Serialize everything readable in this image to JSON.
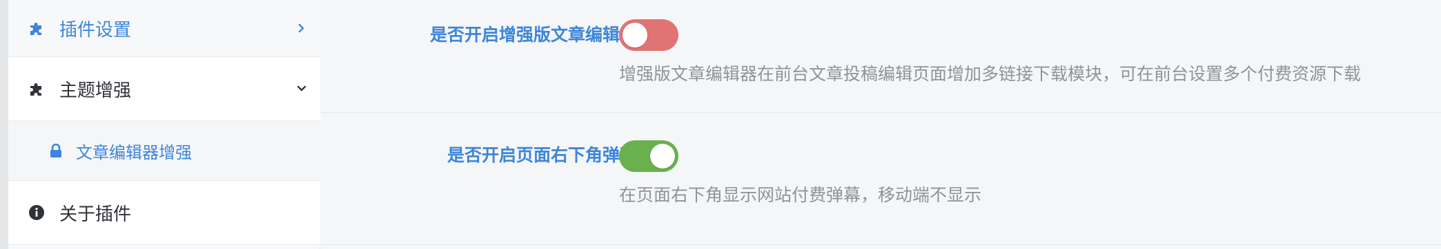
{
  "sidebar": {
    "items": [
      {
        "label": "插件设置",
        "icon": "puzzle-icon",
        "chevron": "chevron-right-icon",
        "state": "active"
      },
      {
        "label": "主题增强",
        "icon": "puzzle-icon",
        "chevron": "chevron-down-icon",
        "state": "expanded"
      },
      {
        "label": "文章编辑器增强",
        "icon": "lock-icon",
        "state": "selected-sub"
      },
      {
        "label": "关于插件",
        "icon": "info-icon"
      }
    ]
  },
  "settings": [
    {
      "label": "是否开启增强版文章编辑器",
      "enabled": false,
      "description": "增强版文章编辑器在前台文章投稿编辑页面增加多链接下载模块，可在前台设置多个付费资源下载"
    },
    {
      "label": "是否开启页面右下角弹幕",
      "enabled": true,
      "description": "在页面右下角显示网站付费弹幕，移动端不显示"
    }
  ],
  "colors": {
    "accent": "#3d86d9",
    "toggle_off": "#e07474",
    "toggle_on": "#6ab04c",
    "text_dark": "#2f3237",
    "text_muted": "#8f9399"
  }
}
